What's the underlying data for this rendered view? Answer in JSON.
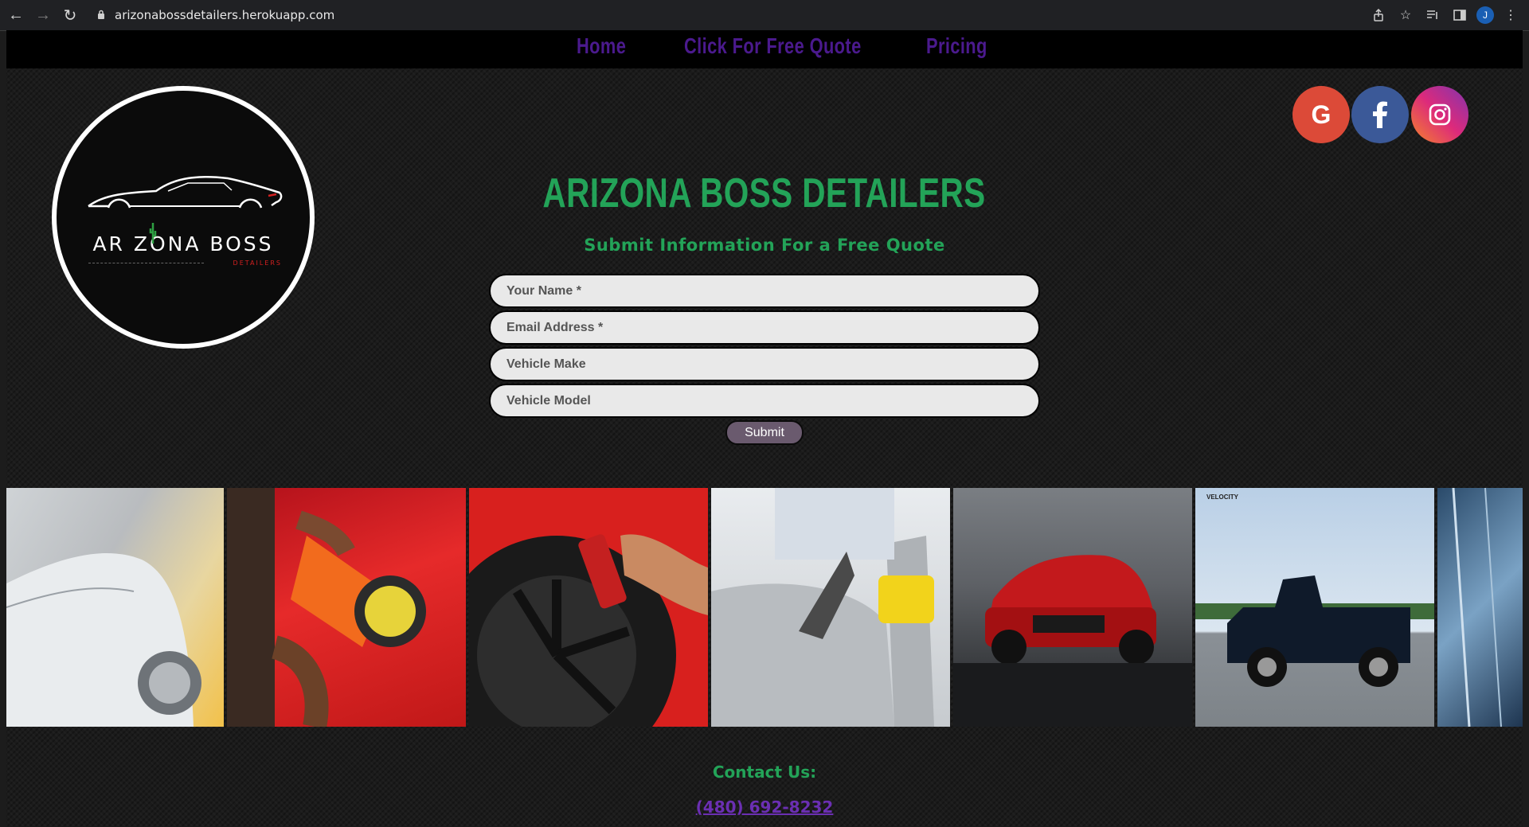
{
  "browser": {
    "url": "arizonabossdetailers.herokuapp.com",
    "profile_initial": "J"
  },
  "nav": {
    "items": [
      {
        "label": "Home"
      },
      {
        "label": "Click For Free Quote"
      },
      {
        "label": "Pricing"
      }
    ]
  },
  "logo": {
    "brand_text": "AR ZONA BOSS",
    "sub_text": "DETAILERS"
  },
  "social": {
    "google_letter": "G",
    "colors": {
      "google": "#dc4a38",
      "facebook": "#3b5998",
      "instagram_from": "#f58529",
      "instagram_to": "#c13584"
    }
  },
  "main": {
    "title": "ARIZONA BOSS DETAILERS",
    "subtitle": "Submit Information For a Free Quote",
    "form": {
      "name_placeholder": "Your Name *",
      "email_placeholder": "Email Address *",
      "make_placeholder": "Vehicle Make",
      "model_placeholder": "Vehicle Model",
      "submit_label": "Submit"
    }
  },
  "gallery": {
    "tiles": [
      "car-foam-wash",
      "orange-polisher",
      "wheel-tire-spray",
      "seat-upholstery-cleaning",
      "red-mustang",
      "blue-classic-pickup",
      "glass-reflection"
    ],
    "banner_text": "VELOCITY"
  },
  "footer": {
    "contact_label": "Contact Us:",
    "phone": "(480) 692-8232"
  },
  "colors": {
    "accent_green": "#23a358",
    "nav_purple": "#4b1a8e",
    "link_purple": "#6b2fb3"
  }
}
